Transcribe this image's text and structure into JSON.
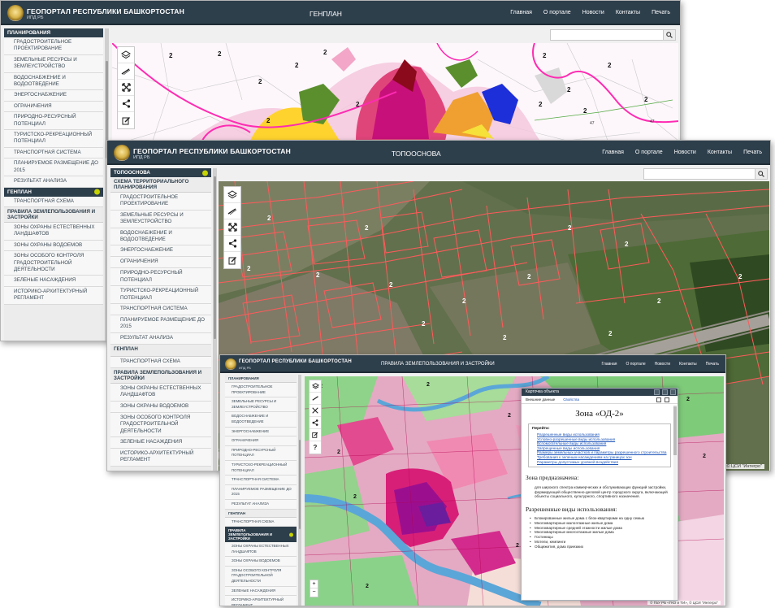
{
  "brand": "ГЕОПОРТАЛ РЕСПУБЛИКИ БАШКОРТОСТАН",
  "brand_sub": "ИПД РБ",
  "nav": [
    "Главная",
    "О портале",
    "Новости",
    "Контакты",
    "Печать"
  ],
  "copyright": "© ЦСИ \"Интегро\"",
  "copyright_front": "© ГБУ РБ «ГКО и ТИ», © ЦСИ \"Интегро\"",
  "map_labels": {
    "two": "2",
    "forty_seven": "47"
  },
  "win_back": {
    "title": "ГЕНПЛАН",
    "groups": [
      {
        "type": "section",
        "label": "ПЛАНИРОВАНИЯ"
      },
      {
        "type": "item",
        "label": "ГРАДОСТРОИТЕЛЬНОЕ ПРОЕКТИРОВАНИЕ"
      },
      {
        "type": "item",
        "label": "ЗЕМЕЛЬНЫЕ РЕСУРСЫ И ЗЕМЛЕУСТРОЙСТВО"
      },
      {
        "type": "item",
        "label": "ВОДОСНАБЖЕНИЕ И ВОДООТВЕДЕНИЕ"
      },
      {
        "type": "item",
        "label": "ЭНЕРГОСНАБЖЕНИЕ"
      },
      {
        "type": "item",
        "label": "ОГРАНИЧЕНИЯ"
      },
      {
        "type": "item",
        "label": "ПРИРОДНО-РЕСУРСНЫЙ ПОТЕНЦИАЛ"
      },
      {
        "type": "item",
        "label": "ТУРИСТСКО-РЕКРЕАЦИОННЫЙ ПОТЕНЦИАЛ"
      },
      {
        "type": "item",
        "label": "ТРАНСПОРТНАЯ СИСТЕМА"
      },
      {
        "type": "item",
        "label": "ПЛАНИРУЕМОЕ РАЗМЕЩЕНИЕ ДО 2015"
      },
      {
        "type": "item",
        "label": "РЕЗУЛЬТАТ АНАЛИЗА"
      },
      {
        "type": "section",
        "label": "ГЕНПЛАН",
        "indicator": true
      },
      {
        "type": "item",
        "label": "ТРАНСПОРТНАЯ СХЕМА"
      },
      {
        "type": "heading",
        "label": "ПРАВИЛА ЗЕМЛЕПОЛЬЗОВАНИЯ И ЗАСТРОЙКИ"
      },
      {
        "type": "item",
        "label": "ЗОНЫ ОХРАНЫ ЕСТЕСТВЕННЫХ ЛАНДШАФТОВ"
      },
      {
        "type": "item",
        "label": "ЗОНЫ ОХРАНЫ ВОДОЕМОВ"
      },
      {
        "type": "item",
        "label": "ЗОНЫ ОСОБОГО КОНТРОЛЯ ГРАДОСТРОИТЕЛЬНОЙ ДЕЯТЕЛЬНОСТИ"
      },
      {
        "type": "item",
        "label": "ЗЕЛЕНЫЕ НАСАЖДЕНИЯ"
      },
      {
        "type": "item",
        "label": "ИСТОРИКО-АРХИТЕКТУРНЫЙ РЕГЛАМЕНТ"
      }
    ]
  },
  "win_mid": {
    "title": "ТОПООСНОВА",
    "groups": [
      {
        "type": "section",
        "label": "ТОПООСНОВА",
        "indicator": true
      },
      {
        "type": "heading",
        "label": "СХЕМА ТЕРРИТОРИАЛЬНОГО ПЛАНИРОВАНИЯ"
      },
      {
        "type": "item",
        "label": "ГРАДОСТРОИТЕЛЬНОЕ ПРОЕКТИРОВАНИЕ"
      },
      {
        "type": "item",
        "label": "ЗЕМЕЛЬНЫЕ РЕСУРСЫ И ЗЕМЛЕУСТРОЙСТВО"
      },
      {
        "type": "item",
        "label": "ВОДОСНАБЖЕНИЕ И ВОДООТВЕДЕНИЕ"
      },
      {
        "type": "item",
        "label": "ЭНЕРГОСНАБЖЕНИЕ"
      },
      {
        "type": "item",
        "label": "ОГРАНИЧЕНИЯ"
      },
      {
        "type": "item",
        "label": "ПРИРОДНО-РЕСУРСНЫЙ ПОТЕНЦИАЛ"
      },
      {
        "type": "item",
        "label": "ТУРИСТСКО-РЕКРЕАЦИОННЫЙ ПОТЕНЦИАЛ"
      },
      {
        "type": "item",
        "label": "ТРАНСПОРТНАЯ СИСТЕМА"
      },
      {
        "type": "item",
        "label": "ПЛАНИРУЕМОЕ РАЗМЕЩЕНИЕ ДО 2015"
      },
      {
        "type": "item",
        "label": "РЕЗУЛЬТАТ АНАЛИЗА"
      },
      {
        "type": "heading",
        "label": "ГЕНПЛАН"
      },
      {
        "type": "item",
        "label": "ТРАНСПОРТНАЯ СХЕМА"
      },
      {
        "type": "heading",
        "label": "ПРАВИЛА ЗЕМЛЕПОЛЬЗОВАНИЯ И ЗАСТРОЙКИ"
      },
      {
        "type": "item",
        "label": "ЗОНЫ ОХРАНЫ ЕСТЕСТВЕННЫХ ЛАНДШАФТОВ"
      },
      {
        "type": "item",
        "label": "ЗОНЫ ОХРАНЫ ВОДОЕМОВ"
      },
      {
        "type": "item",
        "label": "ЗОНЫ ОСОБОГО КОНТРОЛЯ ГРАДОСТРОИТЕЛЬНОЙ ДЕЯТЕЛЬНОСТИ"
      },
      {
        "type": "item",
        "label": "ЗЕЛЕНЫЕ НАСАЖДЕНИЯ"
      },
      {
        "type": "item",
        "label": "ИСТОРИКО-АРХИТЕКТУРНЫЙ РЕГЛАМЕНТ"
      }
    ]
  },
  "win_front": {
    "title": "ПРАВИЛА ЗЕМЛЕПОЛЬЗОВАНИЯ И ЗАСТРОЙКИ",
    "groups": [
      {
        "type": "heading",
        "label": "ПЛАНИРОВАНИЯ"
      },
      {
        "type": "item",
        "label": "ГРАДОСТРОИТЕЛЬНОЕ ПРОЕКТИРОВАНИЕ"
      },
      {
        "type": "item",
        "label": "ЗЕМЕЛЬНЫЕ РЕСУРСЫ И ЗЕМЛЕУСТРОЙСТВО"
      },
      {
        "type": "item",
        "label": "ВОДОСНАБЖЕНИЕ И ВОДООТВЕДЕНИЕ"
      },
      {
        "type": "item",
        "label": "ЭНЕРГОСНАБЖЕНИЕ"
      },
      {
        "type": "item",
        "label": "ОГРАНИЧЕНИЯ"
      },
      {
        "type": "item",
        "label": "ПРИРОДНО-РЕСУРСНЫЙ ПОТЕНЦИАЛ"
      },
      {
        "type": "item",
        "label": "ТУРИСТСКО-РЕКРЕАЦИОННЫЙ ПОТЕНЦИАЛ"
      },
      {
        "type": "item",
        "label": "ТРАНСПОРТНАЯ СИСТЕМА"
      },
      {
        "type": "item",
        "label": "ПЛАНИРУЕМОЕ РАЗМЕЩЕНИЕ ДО 2015"
      },
      {
        "type": "item",
        "label": "РЕЗУЛЬТАТ АНАЛИЗА"
      },
      {
        "type": "heading",
        "label": "ГЕНПЛАН"
      },
      {
        "type": "item",
        "label": "ТРАНСПОРТНАЯ СХЕМА"
      },
      {
        "type": "section",
        "label": "ПРАВИЛА ЗЕМЛЕПОЛЬЗОВАНИЯ И ЗАСТРОЙКИ",
        "indicator": true
      },
      {
        "type": "item",
        "label": "ЗОНЫ ОХРАНЫ ЕСТЕСТВЕННЫХ ЛАНДШАФТОВ"
      },
      {
        "type": "item",
        "label": "ЗОНЫ ОХРАНЫ ВОДОЕМОВ"
      },
      {
        "type": "item",
        "label": "ЗОНЫ ОСОБОГО КОНТРОЛЯ ГРАДОСТРОИТЕЛЬНОЙ ДЕЯТЕЛЬНОСТИ"
      },
      {
        "type": "item",
        "label": "ЗЕЛЕНЫЕ НАСАЖДЕНИЯ"
      },
      {
        "type": "item",
        "label": "ИСТОРИКО-АРХИТЕКТУРНЫЙ РЕГЛАМЕНТ"
      }
    ]
  },
  "card": {
    "title": "Карточка объекта",
    "tabs": [
      "Внешние данные",
      "Свойства"
    ],
    "zone": "Зона «ОД-2»",
    "goto_title": "Перейти:",
    "links": [
      "Разрешенные виды использования",
      "Условно-разрешенные виды использования",
      "Вспомогательные виды использования",
      "Запрещенные виды использования",
      "Размеры земельных участков и параметры разрешенного строительства",
      "Требования к зеленым насаждениям на границах зон",
      "Параметры допустимых уровней воздействия"
    ],
    "purpose_title": "Зона предназначена:",
    "purpose_text": "для широкого спектра коммерческих и обслуживающих функций застройки, формирующей общественно-деловой центр городского округа, включающей объекты социального, культурного, спортивного назначения.",
    "uses_title": "Разрешенные виды использования:",
    "uses": [
      "Блокированные жилые дома с блок-квартирами на одну семью",
      "Многоквартирные малоэтажные жилые дома",
      "Многоквартирные средней этажности жилые дома",
      "Многоквартирные многоэтажные жилые дома",
      "Гостиницы",
      "Мотели, кемпинги",
      "Общежития, дома приезжих"
    ]
  },
  "colors": {
    "header": "#2e3f4c",
    "accent": "#c7d300",
    "link": "#1f56b8"
  }
}
